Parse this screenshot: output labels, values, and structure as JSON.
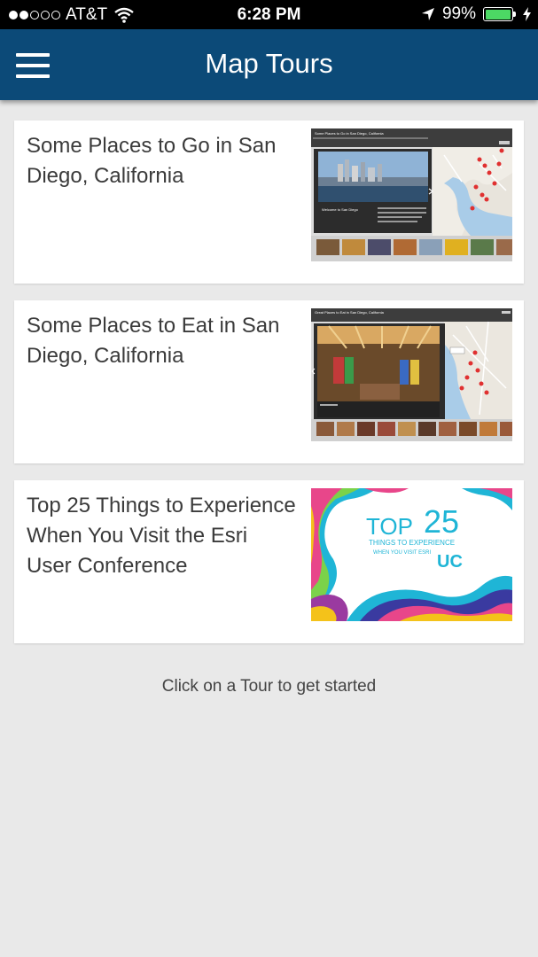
{
  "status_bar": {
    "carrier": "AT&T",
    "time": "6:28 PM",
    "battery": "99%",
    "battery_level": 0.99,
    "signal_bars_filled": 2,
    "signal_bars_total": 5
  },
  "header": {
    "title": "Map Tours"
  },
  "tours": [
    {
      "title": "Some Places to Go in San Diego, California",
      "thumb_header": "Some Places to Go in San Diego, California",
      "thumb_caption": "Welcome to San Diego"
    },
    {
      "title": "Some Places to Eat in San Diego, California",
      "thumb_header": "Great Places to Eat in San Diego, California"
    },
    {
      "title": "Top 25 Things to Experience When You Visit the Esri User Conference",
      "thumb_line1": "TOP",
      "thumb_number": "25",
      "thumb_line2": "THINGS TO EXPERIENCE",
      "thumb_line3": "WHEN YOU VISIT ESRI",
      "thumb_badge": "UC"
    }
  ],
  "footer_hint": "Click on a Tour to get started",
  "colors": {
    "navbar": "#0c4a78",
    "background": "#e9e9e9",
    "battery_fill": "#4cd964"
  }
}
